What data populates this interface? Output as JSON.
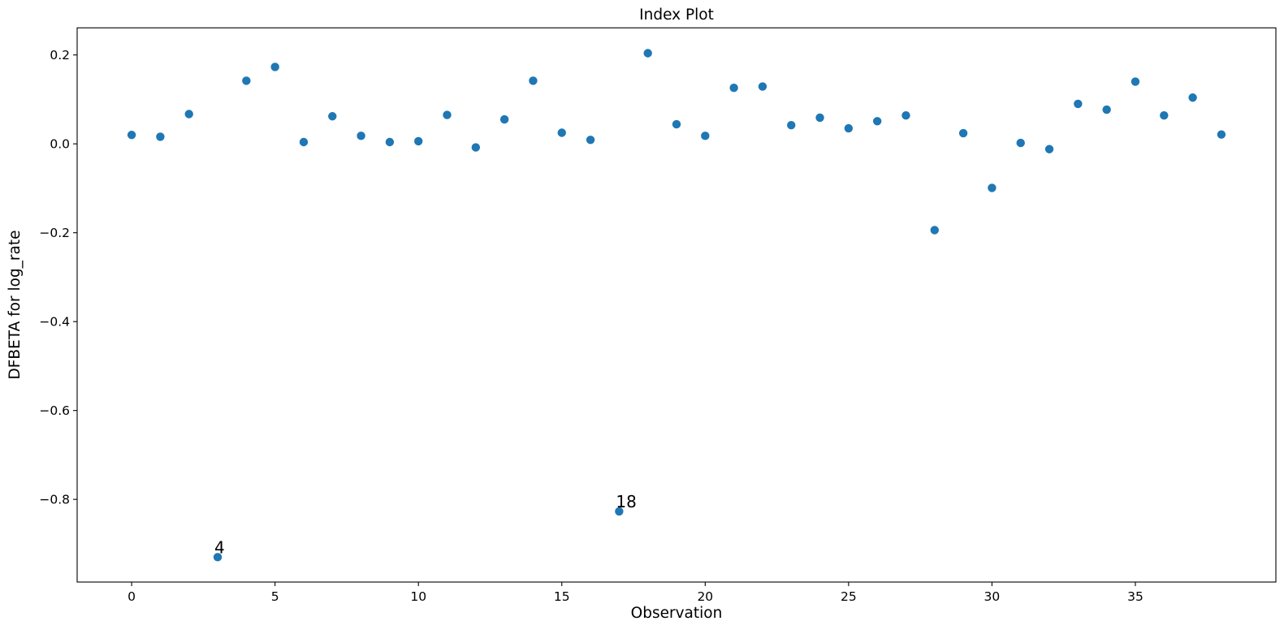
{
  "chart_data": {
    "type": "scatter",
    "title": "Index Plot",
    "xlabel": "Observation",
    "ylabel": "DFBETA for log_rate",
    "xlim": [
      -1.9,
      39.9
    ],
    "ylim": [
      -0.986,
      0.261
    ],
    "xticks": [
      0,
      5,
      10,
      15,
      20,
      25,
      30,
      35
    ],
    "xtick_labels": [
      "0",
      "5",
      "10",
      "15",
      "20",
      "25",
      "30",
      "35"
    ],
    "yticks": [
      0.2,
      0.0,
      -0.2,
      -0.4,
      -0.6,
      -0.8
    ],
    "ytick_labels": [
      "0.2",
      "0.0",
      "−0.2",
      "−0.4",
      "−0.6",
      "−0.8"
    ],
    "grid": false,
    "marker_color": "#1f77b4",
    "x": [
      0,
      1,
      2,
      3,
      4,
      5,
      6,
      7,
      8,
      9,
      10,
      11,
      12,
      13,
      14,
      15,
      16,
      17,
      18,
      19,
      20,
      21,
      22,
      23,
      24,
      25,
      26,
      27,
      28,
      29,
      30,
      31,
      32,
      33,
      34,
      35,
      36,
      37,
      38
    ],
    "y": [
      0.02,
      0.016,
      0.067,
      -0.93,
      0.142,
      0.173,
      0.004,
      0.062,
      0.018,
      0.004,
      0.006,
      0.065,
      -0.008,
      0.055,
      0.142,
      0.025,
      0.009,
      -0.827,
      0.204,
      0.044,
      0.018,
      0.126,
      0.129,
      0.042,
      0.059,
      0.035,
      0.051,
      0.064,
      -0.194,
      0.024,
      -0.099,
      0.002,
      -0.012,
      0.09,
      0.077,
      0.14,
      0.064,
      0.104,
      0.021
    ],
    "annotations": [
      {
        "text": "4",
        "x": 3,
        "y": -0.93
      },
      {
        "text": "18",
        "x": 17,
        "y": -0.827
      }
    ]
  }
}
